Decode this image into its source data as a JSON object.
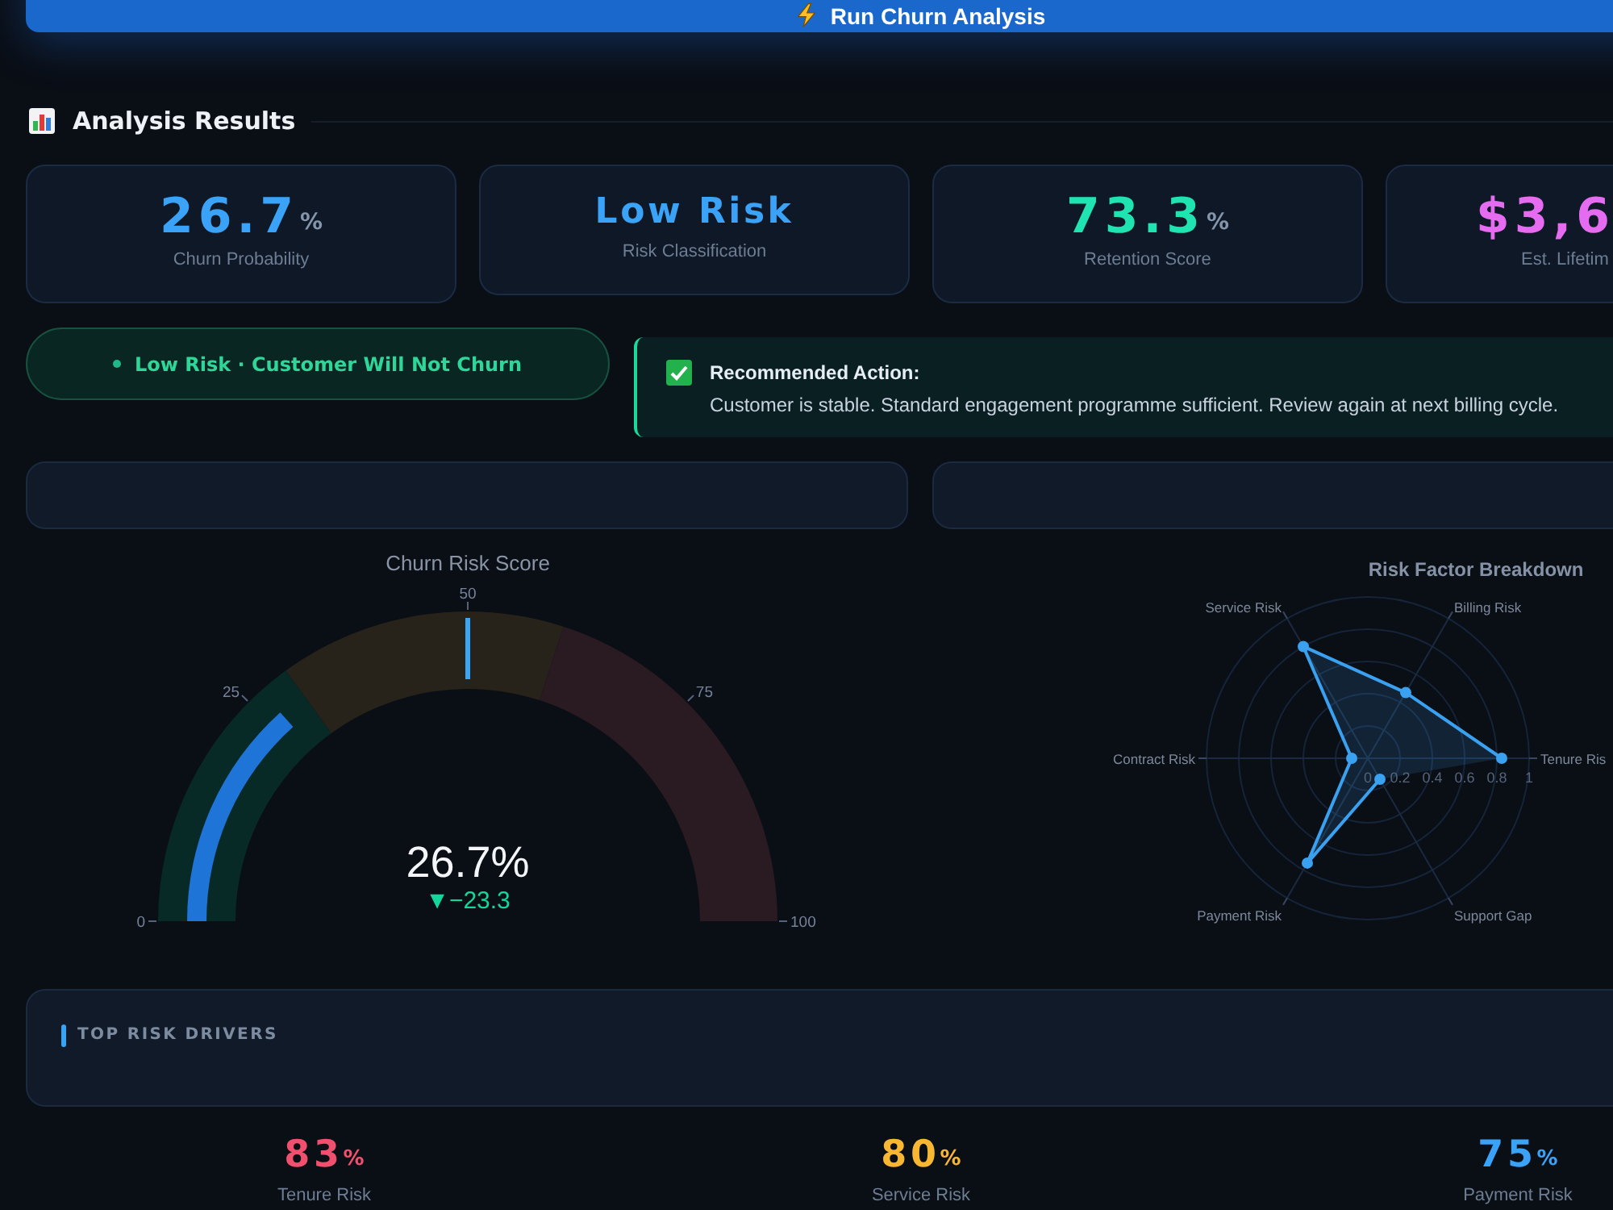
{
  "run_button": {
    "label": "Run Churn Analysis"
  },
  "section": {
    "title": "Analysis Results"
  },
  "metrics": [
    {
      "kind": "number",
      "value": "26.7",
      "unit": "%",
      "label": "Churn Probability",
      "color": "#3aa3f7"
    },
    {
      "kind": "text",
      "value": "Low Risk",
      "label": "Risk Classification",
      "color": "#3aa3f7"
    },
    {
      "kind": "number",
      "value": "73.3",
      "unit": "%",
      "label": "Retention Score",
      "color": "#1fe3b0"
    },
    {
      "kind": "number",
      "value": "$3,6",
      "label": "Est. Lifetim",
      "color": "#e56cf0"
    }
  ],
  "risk_badge": {
    "label": "Low Risk · Customer Will Not Churn"
  },
  "recommendation": {
    "title": "Recommended Action:",
    "text": "Customer is stable. Standard engagement programme sufficient. Review again at next billing cycle."
  },
  "gauge": {
    "title": "Churn Risk Score",
    "value": "26.7%",
    "delta": "▼−23.3",
    "level": 0.267,
    "threshold": {
      "level": 0.5
    },
    "ticks": [
      "0",
      "25",
      "50",
      "75",
      "100"
    ]
  },
  "radar": {
    "title": "Risk Factor Breakdown",
    "axes": [
      "Tenure Ris",
      "Billing Risk",
      "Service Risk",
      "Contract Risk",
      "Payment Risk",
      "Support Gap"
    ],
    "ticks": [
      "0",
      "0.2",
      "0.4",
      "0.6",
      "0.8",
      "1"
    ]
  },
  "risk_drivers": {
    "title": "TOP RISK DRIVERS"
  },
  "drivers": [
    {
      "value": "83",
      "unit": "%",
      "label": "Tenure Risk",
      "color": "#f0506e"
    },
    {
      "value": "80",
      "unit": "%",
      "label": "Service Risk",
      "color": "#f7b733"
    },
    {
      "value": "75",
      "unit": "%",
      "label": "Payment Risk",
      "color": "#3aa3f7"
    }
  ]
}
